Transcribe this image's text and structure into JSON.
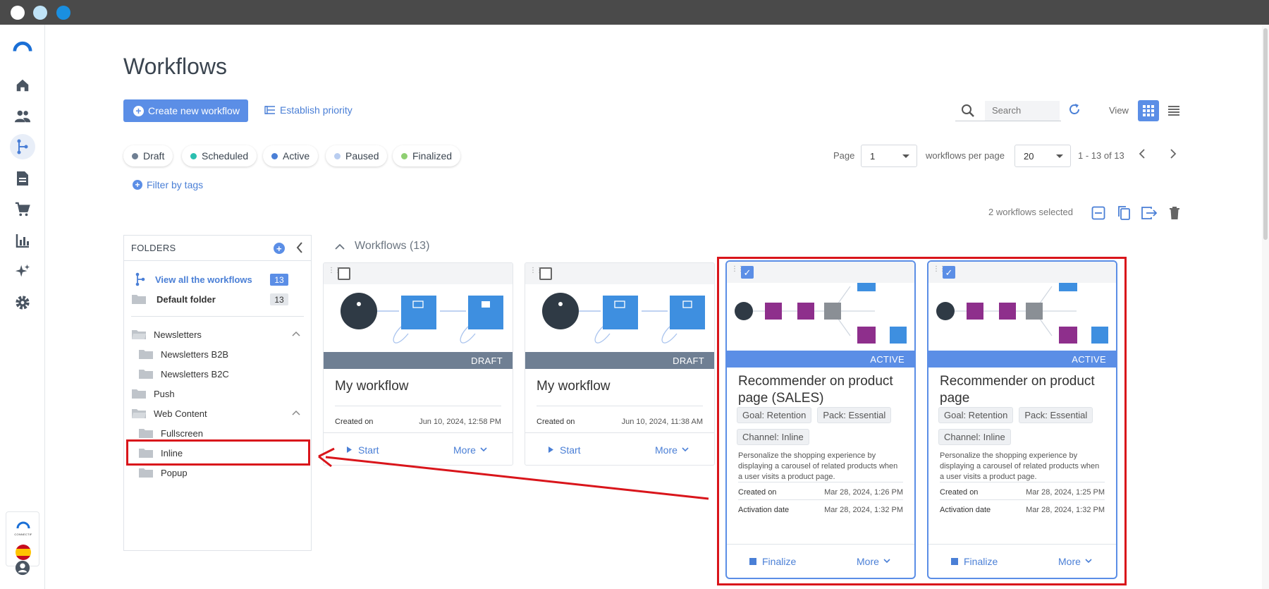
{
  "window": {
    "dots": [
      "#ffffff",
      "#bfe3f7",
      "#1a8fe0"
    ]
  },
  "sidebar": {
    "items": [
      "logo-icon",
      "home-icon",
      "users-icon",
      "workflows-icon",
      "document-icon",
      "cart-icon",
      "chart-icon",
      "sparkle-icon",
      "settings-icon"
    ],
    "bottom": [
      "connectif-logo-icon",
      "spain-flag-icon"
    ],
    "user": "user-icon",
    "bottom_logo_text": "CONNECTIF"
  },
  "header": {
    "title": "Workflows"
  },
  "toolbar": {
    "create_label": "Create new workflow",
    "priority_label": "Establish priority",
    "search_placeholder": "Search",
    "view_label": "View"
  },
  "status_filters": [
    {
      "label": "Draft",
      "color": "#6f7f93"
    },
    {
      "label": "Scheduled",
      "color": "#2bbfb0"
    },
    {
      "label": "Active",
      "color": "#4a7fd6"
    },
    {
      "label": "Paused",
      "color": "#b9cdf0"
    },
    {
      "label": "Finalized",
      "color": "#8fcf72"
    }
  ],
  "filter_tags_label": "Filter by tags",
  "pagination": {
    "page_label": "Page",
    "page_value": "1",
    "per_page_label": "workflows per page",
    "per_page_value": "20",
    "range": "1 - 13 of 13"
  },
  "selection": {
    "count_label": "2 workflows selected"
  },
  "folders": {
    "header": "FOLDERS",
    "view_all": {
      "label": "View all the workflows",
      "count": "13"
    },
    "default": {
      "label": "Default folder",
      "count": "13"
    },
    "tree": [
      {
        "label": "Newsletters",
        "level": 0,
        "expanded": true
      },
      {
        "label": "Newsletters B2B",
        "level": 1
      },
      {
        "label": "Newsletters B2C",
        "level": 1
      },
      {
        "label": "Push",
        "level": 0
      },
      {
        "label": "Web Content",
        "level": 0,
        "expanded": true
      },
      {
        "label": "Fullscreen",
        "level": 1
      },
      {
        "label": "Inline",
        "level": 1
      },
      {
        "label": "Popup",
        "level": 1
      }
    ]
  },
  "section": {
    "title": "Workflows (13)"
  },
  "cards": [
    {
      "title": "My workflow",
      "status": "DRAFT",
      "checked": false,
      "created_label": "Created on",
      "created_value": "Jun 10, 2024, 12:58 PM",
      "action1": "Start",
      "action2": "More"
    },
    {
      "title": "My workflow",
      "status": "DRAFT",
      "checked": false,
      "created_label": "Created on",
      "created_value": "Jun 10, 2024, 11:38 AM",
      "action1": "Start",
      "action2": "More"
    },
    {
      "title": "Recommender on product page (SALES)",
      "status": "ACTIVE",
      "checked": true,
      "tags": [
        "Goal: Retention",
        "Pack: Essential",
        "Channel: Inline"
      ],
      "description": "Personalize the shopping experience by displaying a carousel of related products when a user visits a product page.",
      "created_label": "Created on",
      "created_value": "Mar 28, 2024, 1:26 PM",
      "activation_label": "Activation date",
      "activation_value": "Mar 28, 2024, 1:32 PM",
      "action1": "Finalize",
      "action2": "More"
    },
    {
      "title": "Recommender on product page",
      "status": "ACTIVE",
      "checked": true,
      "tags": [
        "Goal: Retention",
        "Pack: Essential",
        "Channel: Inline"
      ],
      "description": "Personalize the shopping experience by displaying a carousel of related products when a user visits a product page.",
      "created_label": "Created on",
      "created_value": "Mar 28, 2024, 1:25 PM",
      "activation_label": "Activation date",
      "activation_value": "Mar 28, 2024, 1:32 PM",
      "action1": "Finalize",
      "action2": "More"
    }
  ],
  "annotation_color": "#d9151b"
}
